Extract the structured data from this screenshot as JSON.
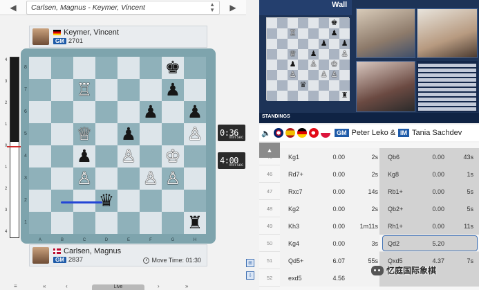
{
  "game_select": {
    "prev_icon": "caret-left-icon",
    "title": "Carlsen, Magnus - Keymer, Vincent",
    "next_icon": "caret-right-icon"
  },
  "top_player": {
    "name": "Keymer, Vincent",
    "title": "GM",
    "rating": "2701",
    "flag": "germany"
  },
  "bottom_player": {
    "name": "Carlsen, Magnus",
    "title": "GM",
    "rating": "2837",
    "flag": "norway",
    "move_time_label": "Move Time: 01:30"
  },
  "clocks": {
    "top": {
      "time": "0:36",
      "units": "min sec"
    },
    "bottom": {
      "time": "4:00",
      "units": "min sec"
    }
  },
  "eval_bar": {
    "labels": [
      "4",
      "3",
      "2",
      "1",
      "0",
      "1",
      "2",
      "3",
      "4"
    ],
    "black_fraction": 0.47
  },
  "board": {
    "ranks": [
      "8",
      "7",
      "6",
      "5",
      "4",
      "3",
      "2",
      "1"
    ],
    "files": [
      "A",
      "B",
      "C",
      "D",
      "E",
      "F",
      "G",
      "H"
    ],
    "pieces": [
      {
        "sq": "g8",
        "glyph": "♚",
        "color": "b"
      },
      {
        "sq": "c7",
        "glyph": "♖",
        "color": "w"
      },
      {
        "sq": "g7",
        "glyph": "♟",
        "color": "b"
      },
      {
        "sq": "f6",
        "glyph": "♟",
        "color": "b"
      },
      {
        "sq": "h6",
        "glyph": "♟",
        "color": "b"
      },
      {
        "sq": "c5",
        "glyph": "♕",
        "color": "w"
      },
      {
        "sq": "e5",
        "glyph": "♟",
        "color": "b"
      },
      {
        "sq": "h5",
        "glyph": "♙",
        "color": "w"
      },
      {
        "sq": "c4",
        "glyph": "♟",
        "color": "b"
      },
      {
        "sq": "e4",
        "glyph": "♙",
        "color": "w"
      },
      {
        "sq": "g4",
        "glyph": "♔",
        "color": "w"
      },
      {
        "sq": "c3",
        "glyph": "♙",
        "color": "w"
      },
      {
        "sq": "f3",
        "glyph": "♙",
        "color": "w"
      },
      {
        "sq": "g3",
        "glyph": "♙",
        "color": "w"
      },
      {
        "sq": "d2",
        "glyph": "♛",
        "color": "b"
      },
      {
        "sq": "h1",
        "glyph": "♜",
        "color": "b"
      }
    ]
  },
  "broadcast": {
    "wall_text": "Wall",
    "ticker_label": "STANDINGS"
  },
  "commentary": {
    "speaker_icon": "speaker-icon",
    "commentator1_title": "GM",
    "commentator1_name": "Peter Leko",
    "amp": "&",
    "commentator2_title": "IM",
    "commentator2_name": "Tania Sachdev"
  },
  "moves": [
    {
      "num": "46",
      "white": "Kg1",
      "w_eval": "0.00",
      "w_time": "2s",
      "black": "Qb6",
      "b_eval": "0.00",
      "b_time": "43s"
    },
    {
      "num": "46",
      "white": "Rd7+",
      "w_eval": "0.00",
      "w_time": "2s",
      "black": "Kg8",
      "b_eval": "0.00",
      "b_time": "1s"
    },
    {
      "num": "47",
      "white": "Rxc7",
      "w_eval": "0.00",
      "w_time": "14s",
      "black": "Rb1+",
      "b_eval": "0.00",
      "b_time": "5s"
    },
    {
      "num": "48",
      "white": "Kg2",
      "w_eval": "0.00",
      "w_time": "2s",
      "black": "Qb2+",
      "b_eval": "0.00",
      "b_time": "5s"
    },
    {
      "num": "49",
      "white": "Kh3",
      "w_eval": "0.00",
      "w_time": "1m11s",
      "black": "Rh1+",
      "b_eval": "0.00",
      "b_time": "11s"
    },
    {
      "num": "50",
      "white": "Kg4",
      "w_eval": "0.00",
      "w_time": "3s",
      "black": "Qd2",
      "b_eval": "5.20",
      "b_time": ""
    },
    {
      "num": "51",
      "white": "Qd5+",
      "w_eval": "6.07",
      "w_time": "55s",
      "black": "Qxd5",
      "b_eval": "4.37",
      "b_time": "7s"
    },
    {
      "num": "52",
      "white": "exd5",
      "w_eval": "4.56",
      "w_time": "",
      "black": "",
      "b_eval": "",
      "b_time": ""
    }
  ],
  "watermark": "忆庭国际象棋",
  "controls": {
    "live_label": "Live"
  }
}
